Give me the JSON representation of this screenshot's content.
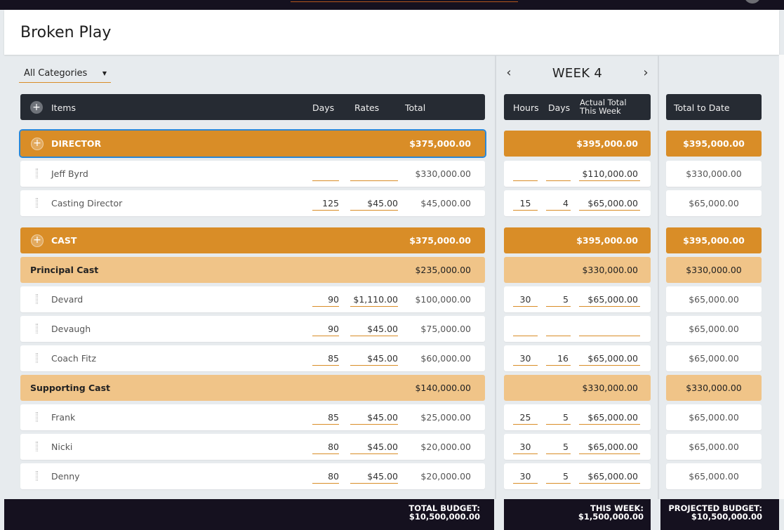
{
  "page_title": "Broken Play",
  "filter": {
    "selected": "All Categories"
  },
  "week": {
    "label": "WEEK 4",
    "prev": "‹",
    "next": "›"
  },
  "headers": {
    "items": "Items",
    "days": "Days",
    "rates": "Rates",
    "total": "Total",
    "hours": "Hours",
    "week_days": "Days",
    "actual_total_line1": "Actual Total",
    "actual_total_line2": "This Week",
    "total_to_date": "Total to Date"
  },
  "rows": [
    {
      "type": "cat",
      "label": "DIRECTOR",
      "total": "$375,000.00",
      "week_total": "$395,000.00",
      "to_date": "$395,000.00"
    },
    {
      "type": "item",
      "label": "Jeff Byrd",
      "days": "",
      "rate": "",
      "total": "$330,000.00",
      "hours": "",
      "wdays": "",
      "week_total": "$110,000.00",
      "to_date": "$330,000.00"
    },
    {
      "type": "item",
      "label": "Casting Director",
      "days": "125",
      "rate": "$45.00",
      "total": "$45,000.00",
      "hours": "15",
      "wdays": "4",
      "week_total": "$65,000.00",
      "to_date": "$65,000.00"
    },
    {
      "type": "cat",
      "label": "CAST",
      "total": "$375,000.00",
      "week_total": "$395,000.00",
      "to_date": "$395,000.00"
    },
    {
      "type": "sub",
      "label": "Principal Cast",
      "total": "$235,000.00",
      "week_total": "$330,000.00",
      "to_date": "$330,000.00"
    },
    {
      "type": "item",
      "label": "Devard",
      "days": "90",
      "rate": "$1,110.00",
      "total": "$100,000.00",
      "hours": "30",
      "wdays": "5",
      "week_total": "$65,000.00",
      "to_date": "$65,000.00"
    },
    {
      "type": "item",
      "label": "Devaugh",
      "days": "90",
      "rate": "$45.00",
      "total": "$75,000.00",
      "hours": "",
      "wdays": "",
      "week_total": "",
      "to_date": "$65,000.00"
    },
    {
      "type": "item",
      "label": "Coach Fitz",
      "days": "85",
      "rate": "$45.00",
      "total": "$60,000.00",
      "hours": "30",
      "wdays": "16",
      "week_total": "$65,000.00",
      "to_date": "$65,000.00"
    },
    {
      "type": "sub",
      "label": "Supporting Cast",
      "total": "$140,000.00",
      "week_total": "$330,000.00",
      "to_date": "$330,000.00"
    },
    {
      "type": "item",
      "label": "Frank",
      "days": "85",
      "rate": "$45.00",
      "total": "$25,000.00",
      "hours": "25",
      "wdays": "5",
      "week_total": "$65,000.00",
      "to_date": "$65,000.00"
    },
    {
      "type": "item",
      "label": "Nicki",
      "days": "80",
      "rate": "$45.00",
      "total": "$20,000.00",
      "hours": "30",
      "wdays": "5",
      "week_total": "$65,000.00",
      "to_date": "$65,000.00"
    },
    {
      "type": "item",
      "label": "Denny",
      "days": "80",
      "rate": "$45.00",
      "total": "$20,000.00",
      "hours": "30",
      "wdays": "5",
      "week_total": "$65,000.00",
      "to_date": "$65,000.00"
    }
  ],
  "footer": {
    "total_budget_label": "TOTAL BUDGET:",
    "total_budget_value": "$10,500,000.00",
    "this_week_label": "THIS WEEK:",
    "this_week_value": "$1,500,000.00",
    "projected_label": "PROJECTED BUDGET:",
    "projected_value": "$10,500,000.00"
  },
  "colors": {
    "category": "#d98d27",
    "subcategory": "#f0c488",
    "header": "#262b33",
    "selection": "#2a87d6"
  }
}
